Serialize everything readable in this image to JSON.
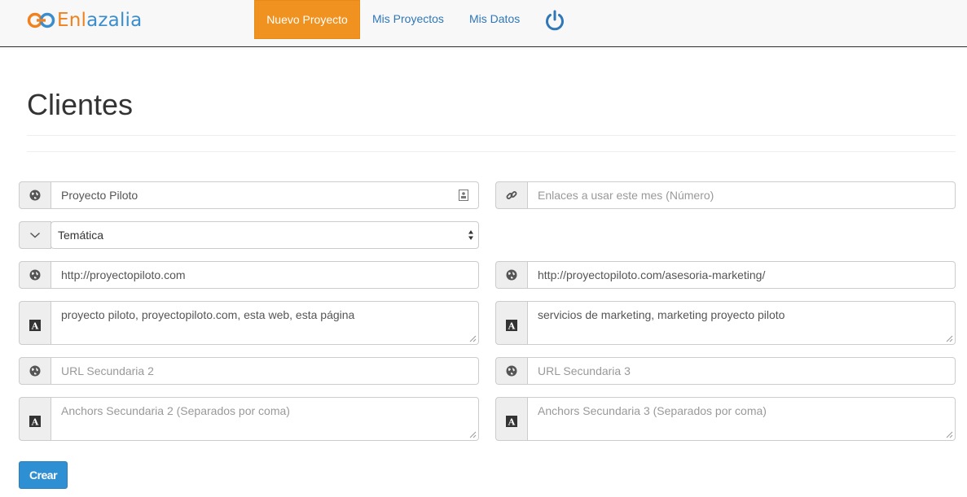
{
  "brand": {
    "part1": "Enl",
    "part2": "azalia"
  },
  "nav": {
    "nuevo_proyecto": "Nuevo Proyecto",
    "mis_proyectos": "Mis Proyectos",
    "mis_datos": "Mis Datos"
  },
  "page": {
    "title": "Clientes"
  },
  "form": {
    "project_name": {
      "value": "Proyecto Piloto",
      "icon": "globe-icon"
    },
    "links_per_month": {
      "placeholder": "Enlaces a usar este mes (Número)",
      "icon": "link-icon"
    },
    "tematica": {
      "selected": "Temática",
      "icon": "chevron-down-icon"
    },
    "main_url": {
      "value": "http://proyectopiloto.com",
      "icon": "globe-icon"
    },
    "secondary_url_1": {
      "value": "http://proyectopiloto.com/asesoria-marketing/",
      "icon": "globe-icon"
    },
    "main_anchors": {
      "value": "proyecto piloto, proyectopiloto.com, esta web, esta página",
      "icon": "font-icon"
    },
    "secondary_anchors_1": {
      "value": "servicios de marketing, marketing proyecto piloto",
      "icon": "font-icon"
    },
    "secondary_url_2": {
      "placeholder": "URL Secundaria 2",
      "icon": "globe-icon"
    },
    "secondary_url_3": {
      "placeholder": "URL Secundaria 3",
      "icon": "globe-icon"
    },
    "secondary_anchors_2": {
      "placeholder": "Anchors Secundaria 2 (Separados por coma)",
      "icon": "font-icon"
    },
    "secondary_anchors_3": {
      "placeholder": "Anchors Secundaria 3 (Separados por coma)",
      "icon": "font-icon"
    }
  },
  "actions": {
    "crear": "Crear"
  },
  "colors": {
    "accent_orange": "#f0921f",
    "link_blue": "#2f77b7",
    "button_blue": "#2f8fd3"
  }
}
